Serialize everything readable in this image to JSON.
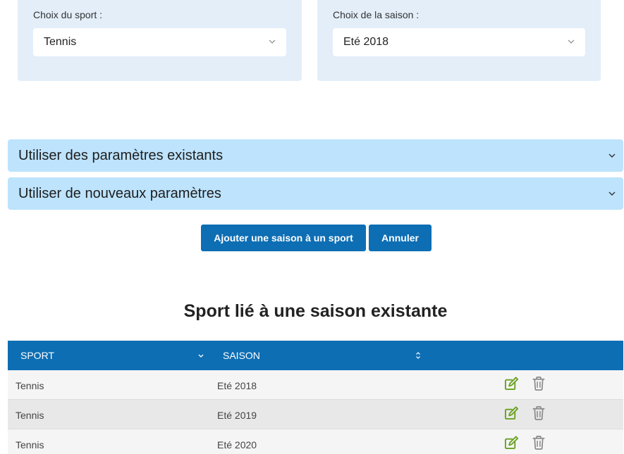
{
  "filters": {
    "sport": {
      "label": "Choix du sport :",
      "value": "Tennis"
    },
    "season": {
      "label": "Choix de la saison :",
      "value": "Eté 2018"
    }
  },
  "accordions": [
    {
      "label": "Utiliser des paramètres existants"
    },
    {
      "label": "Utiliser de nouveaux paramètres"
    }
  ],
  "buttons": {
    "add_label": "Ajouter une saison à un sport",
    "cancel_label": "Annuler"
  },
  "section_title": "Sport lié à une saison existante",
  "table": {
    "columns": [
      "SPORT",
      "SAISON"
    ],
    "rows": [
      {
        "sport": "Tennis",
        "saison": "Eté 2018"
      },
      {
        "sport": "Tennis",
        "saison": "Eté 2019"
      },
      {
        "sport": "Tennis",
        "saison": "Eté 2020"
      }
    ]
  },
  "icons": {
    "select_chevron": "chevron-down-icon",
    "accordion_chevron": "chevron-down-icon",
    "sort_desc": "sort-down-icon",
    "sort_both": "sort-icon",
    "edit": "edit-icon",
    "delete": "trash-icon"
  },
  "colors": {
    "primary": "#0d6eb4",
    "panel_bg": "#e3eef9",
    "accordion_bg": "#bde3fd",
    "edit_icon": "#6aa123",
    "trash_icon": "#8a8a8a"
  }
}
